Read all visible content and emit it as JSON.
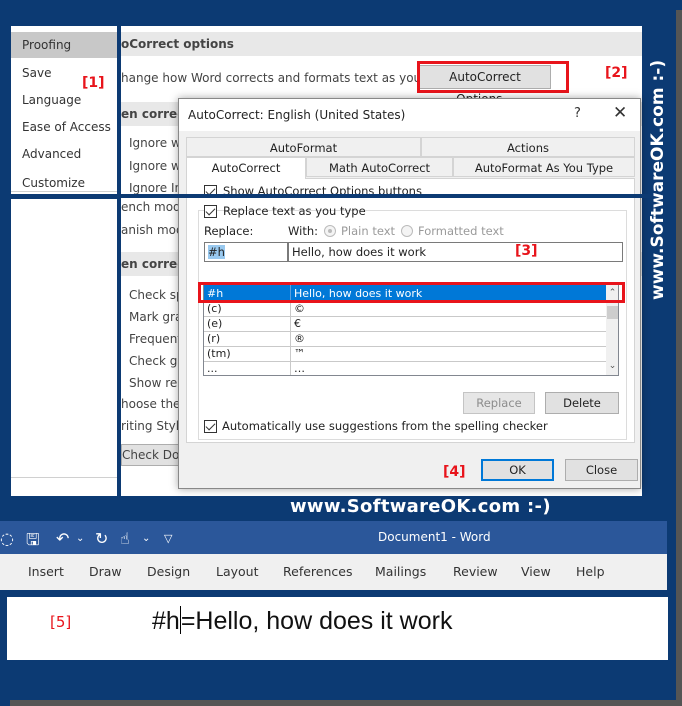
{
  "options": {
    "nav": [
      "Proofing",
      "Save",
      "Language",
      "Ease of Access",
      "Advanced",
      "Customize Ribbon"
    ],
    "active_nav": "Proofing",
    "section1_title": "oCorrect options",
    "section1_desc": "hange how Word corrects and formats text as you type:",
    "autocorrect_options_button": "AutoCorrect Options...",
    "section2_title": "en correct",
    "section2_items": [
      "Ignore wo",
      "Ignore wo",
      "Ignore Int"
    ],
    "mode_items": [
      "ench mode",
      "anish mod"
    ],
    "section3_title": "en correct",
    "section3_items": [
      "Check sp",
      "Mark gra",
      "Frequentl",
      "Check gra",
      "Show rea"
    ],
    "choose_text": "hoose the c",
    "writing_style": "riting Style",
    "check_doc": "Check Docu"
  },
  "dialog": {
    "title": "AutoCorrect: English (United States)",
    "help": "?",
    "close": "✕",
    "tabs_back": [
      "AutoFormat",
      "Actions"
    ],
    "tabs_front": [
      "AutoCorrect",
      "Math AutoCorrect",
      "AutoFormat As You Type"
    ],
    "active_tab": "AutoCorrect",
    "show_buttons_label": "Show AutoCorrect Options buttons",
    "replace_as_type_label": "Replace text as you type",
    "replace_label": "Replace:",
    "with_label": "With:",
    "plain_text_label": "Plain text",
    "formatted_text_label": "Formatted text",
    "replace_value": "#h",
    "with_value": "Hello, how does it work",
    "entries": [
      {
        "from": "#h",
        "to": "Hello, how does it work",
        "selected": true
      },
      {
        "from": "(c)",
        "to": "©"
      },
      {
        "from": "(e)",
        "to": "€"
      },
      {
        "from": "(r)",
        "to": "®"
      },
      {
        "from": "(tm)",
        "to": "™"
      },
      {
        "from": "...",
        "to": "…"
      }
    ],
    "replace_button": "Replace",
    "delete_button": "Delete",
    "auto_suggest_label": "Automatically use suggestions from the spelling checker",
    "ok_button": "OK",
    "close_button": "Close"
  },
  "annotations": [
    "[1]",
    "[2]",
    "[3]",
    "[4]",
    "[5]"
  ],
  "word": {
    "title": "Document1  -  Word",
    "ribbon_tabs": [
      "Insert",
      "Draw",
      "Design",
      "Layout",
      "References",
      "Mailings",
      "Review",
      "View",
      "Help"
    ],
    "doc_before_caret": "#h",
    "doc_after_caret": "=Hello, how does it work"
  },
  "watermark": {
    "footer": "www.SoftwareOK.com :-)",
    "side": "www.SoftwareOK.com :-)"
  },
  "colors": {
    "frame": "#0c3a73",
    "accent_red": "#e8141b",
    "selection_blue": "#0078d7",
    "word_blue": "#2b579a"
  }
}
